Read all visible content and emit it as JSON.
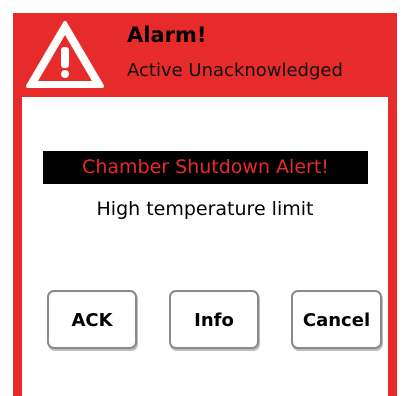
{
  "header": {
    "icon": "warning-triangle-icon",
    "title": "Alarm!",
    "subtitle": "Active Unacknowledged"
  },
  "alert": {
    "title": "Chamber Shutdown Alert!",
    "message": "High temperature limit"
  },
  "buttons": {
    "ack_label": "ACK",
    "info_label": "Info",
    "cancel_label": "Cancel"
  },
  "colors": {
    "accent": "#e72b2a",
    "alert_title_bg": "#000000",
    "content_bg": "#ffffff"
  }
}
